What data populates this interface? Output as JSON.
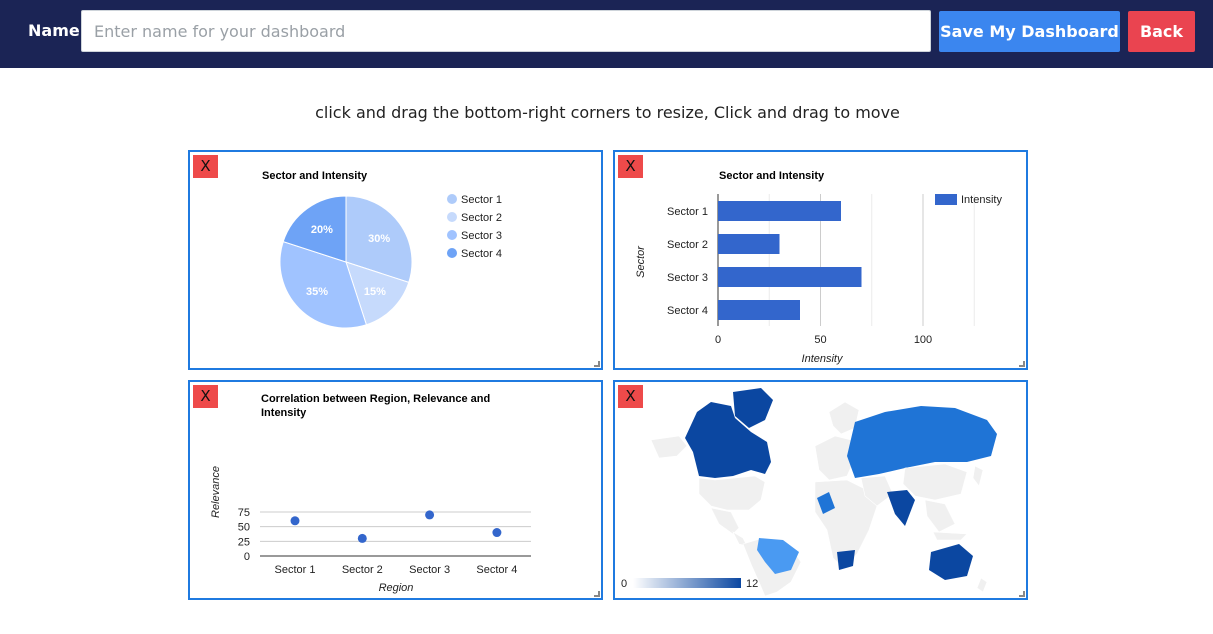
{
  "header": {
    "name_label": "Name",
    "name_input": {
      "value": "",
      "placeholder": "Enter name for your dashboard"
    },
    "save_label": "Save My Dashboard",
    "back_label": "Back",
    "colors": {
      "bar": "#1b2455",
      "save": "#3b86ef",
      "back": "#ea4450"
    }
  },
  "instructions": "click and drag the bottom-right corners to resize, Click and drag to move",
  "close_label": "X",
  "chart_data": [
    {
      "type": "pie",
      "title": "Sector and Intensity",
      "categories": [
        "Sector 1",
        "Sector 2",
        "Sector 3",
        "Sector 4"
      ],
      "values": [
        30,
        15,
        35,
        20
      ],
      "slice_labels": [
        "30%",
        "15%",
        "35%",
        "20%"
      ],
      "colors": [
        "#aecbfa",
        "#c6dafc",
        "#a0c3ff",
        "#6ea3f6"
      ],
      "legend": "right"
    },
    {
      "type": "bar",
      "orientation": "horizontal",
      "title": "Sector and Intensity",
      "categories": [
        "Sector 1",
        "Sector 2",
        "Sector 3",
        "Sector 4"
      ],
      "series": [
        {
          "name": "Intensity",
          "values": [
            60,
            30,
            70,
            40
          ]
        }
      ],
      "xlabel": "Intensity",
      "ylabel": "Sector",
      "xlim": [
        0,
        150
      ],
      "xticks": [
        "0",
        "50",
        "100"
      ],
      "color": "#3366cc",
      "legend": "top-right"
    },
    {
      "type": "scatter",
      "title_lines": [
        "Correlation between Region, Relevance and",
        "Intensity"
      ],
      "categories": [
        "Sector 1",
        "Sector 2",
        "Sector 3",
        "Sector 4"
      ],
      "values": [
        60,
        30,
        70,
        40
      ],
      "xlabel": "Region",
      "ylabel": "Relevance",
      "ylim": [
        0,
        75
      ],
      "yticks": [
        "75",
        "50",
        "25",
        "0"
      ],
      "color": "#3366cc"
    },
    {
      "type": "heatmap",
      "subtype": "geo",
      "legend_min": "0",
      "legend_max": "12",
      "colors": {
        "low": "#eaf2fd",
        "high": "#0b47a1",
        "mid": "#1f74d6",
        "light": "#4a9af2",
        "empty": "#f0f0f0"
      }
    }
  ]
}
